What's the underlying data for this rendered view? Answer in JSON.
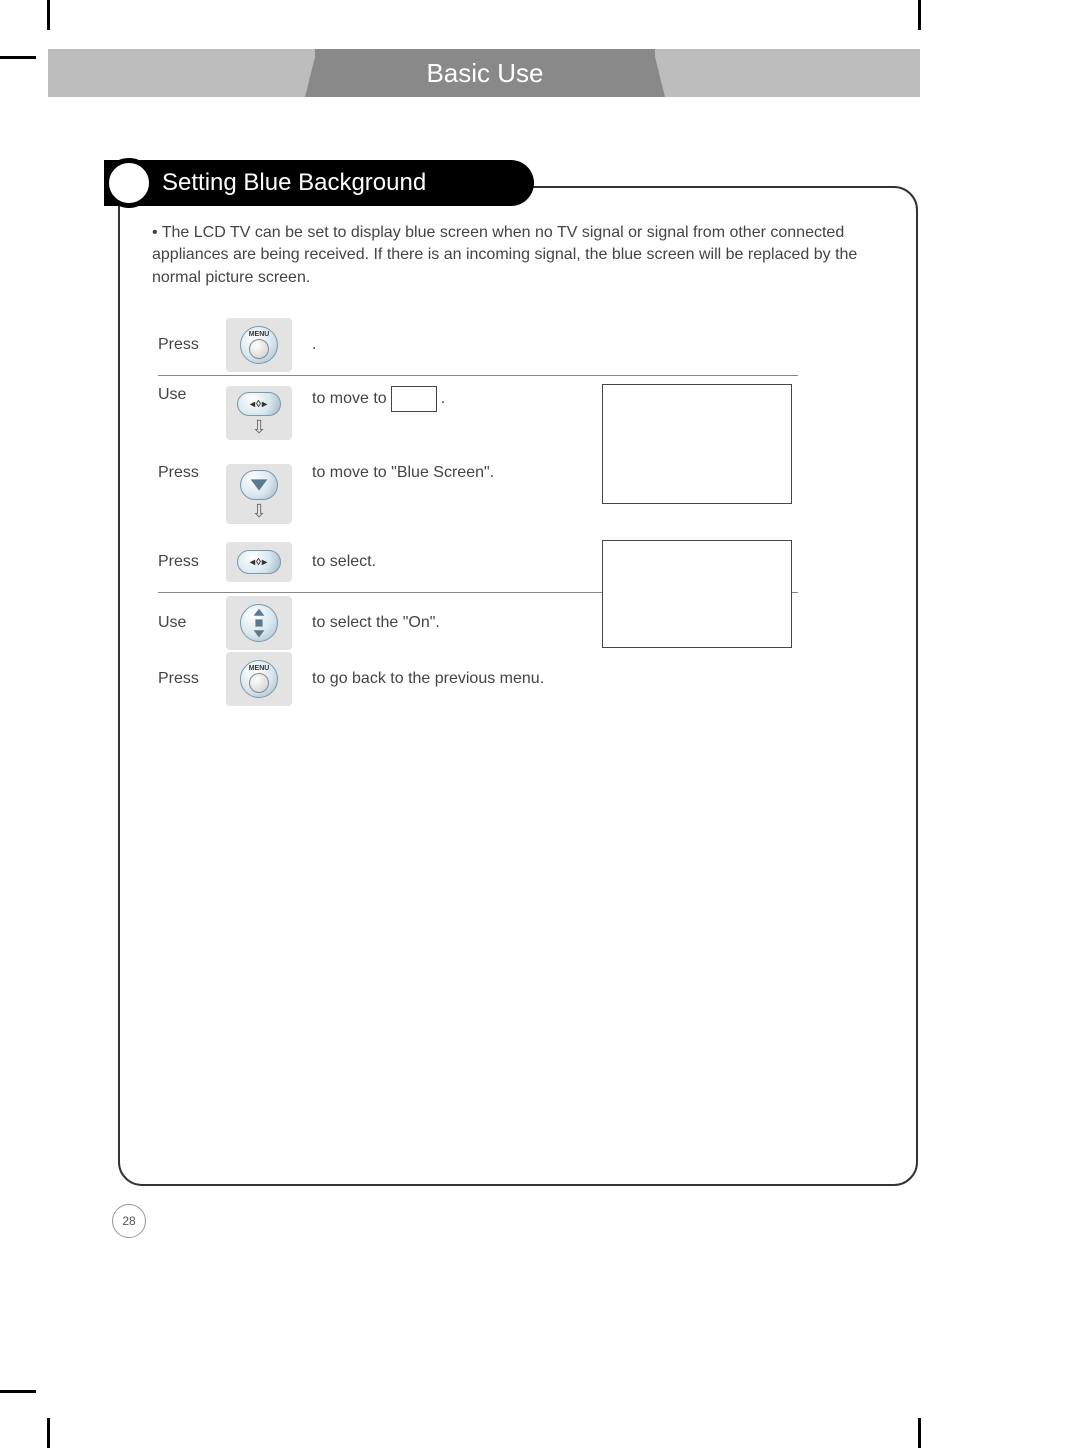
{
  "header": {
    "title": "Basic Use"
  },
  "section": {
    "title": "Setting Blue Background"
  },
  "intro": "• The LCD TV can be set to display blue screen when no TV signal or signal from other connected appliances are being received.  If there is an incoming signal, the blue screen will be replaced by the normal picture screen.",
  "steps": [
    {
      "label": "Press",
      "desc_suffix": "."
    },
    {
      "label": "Use",
      "desc_prefix": "to move to",
      "desc_suffix": "."
    },
    {
      "label": "Press",
      "desc": "to move to \"Blue Screen\"."
    },
    {
      "label": "Press",
      "desc": "to select."
    },
    {
      "label": "Use",
      "desc": "to select the \"On\"."
    },
    {
      "label": "Press",
      "desc": "to go back to the previous menu."
    }
  ],
  "page_number": "28"
}
